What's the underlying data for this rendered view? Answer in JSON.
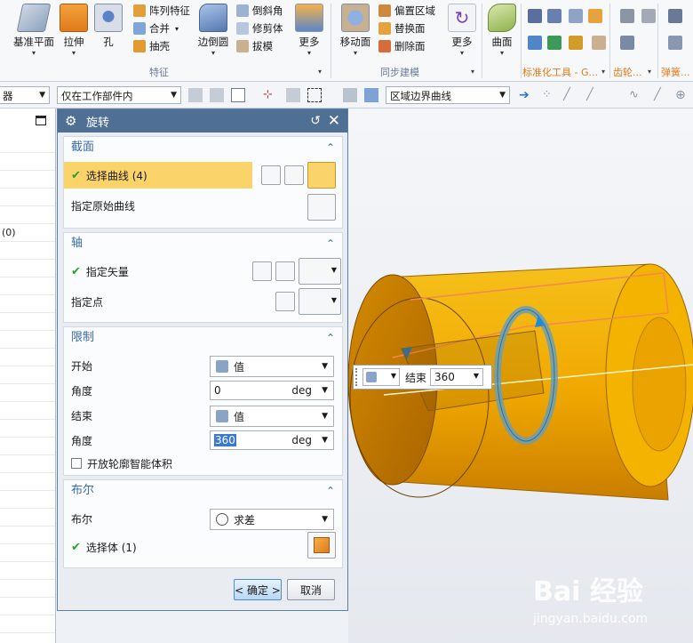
{
  "ribbon": {
    "big_buttons": [
      {
        "id": "datum",
        "label": "基准平面",
        "has_dropdown": true
      },
      {
        "id": "extrude",
        "label": "拉伸",
        "has_dropdown": true
      },
      {
        "id": "hole",
        "label": "孔",
        "has_dropdown": false
      },
      {
        "id": "edge_blend",
        "label": "边倒圆",
        "has_dropdown": true
      },
      {
        "id": "more1",
        "label": "更多",
        "has_dropdown": true
      },
      {
        "id": "move_face",
        "label": "移动面",
        "has_dropdown": true
      },
      {
        "id": "more2",
        "label": "更多",
        "has_dropdown": true
      },
      {
        "id": "surface",
        "label": "曲面",
        "has_dropdown": true
      }
    ],
    "small_items": {
      "pattern": "阵列特征",
      "unite": "合并",
      "shell": "抽壳",
      "chamfer": "倒斜角",
      "trim_body": "修剪体",
      "draft": "拔模",
      "offset_region": "偏置区域",
      "replace_face": "替换面",
      "delete_face": "删除面"
    },
    "groups": {
      "feature": "特征",
      "sync": "同步建模",
      "standard_tools": "标准化工具 - G...",
      "gear": "齿轮...",
      "spring": "弹簧..."
    }
  },
  "selbar": {
    "filter_value": "器",
    "scope_value": "仅在工作部件内",
    "curve_rule_value": "区域边界曲线"
  },
  "navigator": {
    "partial_text": "(0)"
  },
  "dialog": {
    "title": "旋转",
    "section_curve": {
      "header": "截面",
      "select_curve": "选择曲线 (4)",
      "specify_origin_curve": "指定原始曲线"
    },
    "section_axis": {
      "header": "轴",
      "specify_vector": "指定矢量",
      "specify_point": "指定点"
    },
    "section_limits": {
      "header": "限制",
      "start_label": "开始",
      "start_option": "值",
      "start_angle_label": "角度",
      "start_angle_value": "0",
      "end_label": "结束",
      "end_option": "值",
      "end_angle_label": "角度",
      "end_angle_value": "360",
      "unit": "deg",
      "open_profile_label": "开放轮廓智能体积"
    },
    "section_boolean": {
      "header": "布尔",
      "boolean_label": "布尔",
      "boolean_value": "求差",
      "select_body": "选择体 (1)"
    },
    "ok_label": "< 确定 >",
    "cancel_label": "取消"
  },
  "float_input": {
    "end_label": "结束",
    "end_value": "360"
  },
  "watermark": {
    "text": "Bai 经验",
    "url": "jingyan.baidu.com"
  },
  "colors": {
    "accent": "#4f6f95",
    "highlight": "#fbd36b",
    "section_header": "#3a6aa8",
    "model": "#f0a800",
    "ribbon_group_label": "#6b7a99"
  }
}
